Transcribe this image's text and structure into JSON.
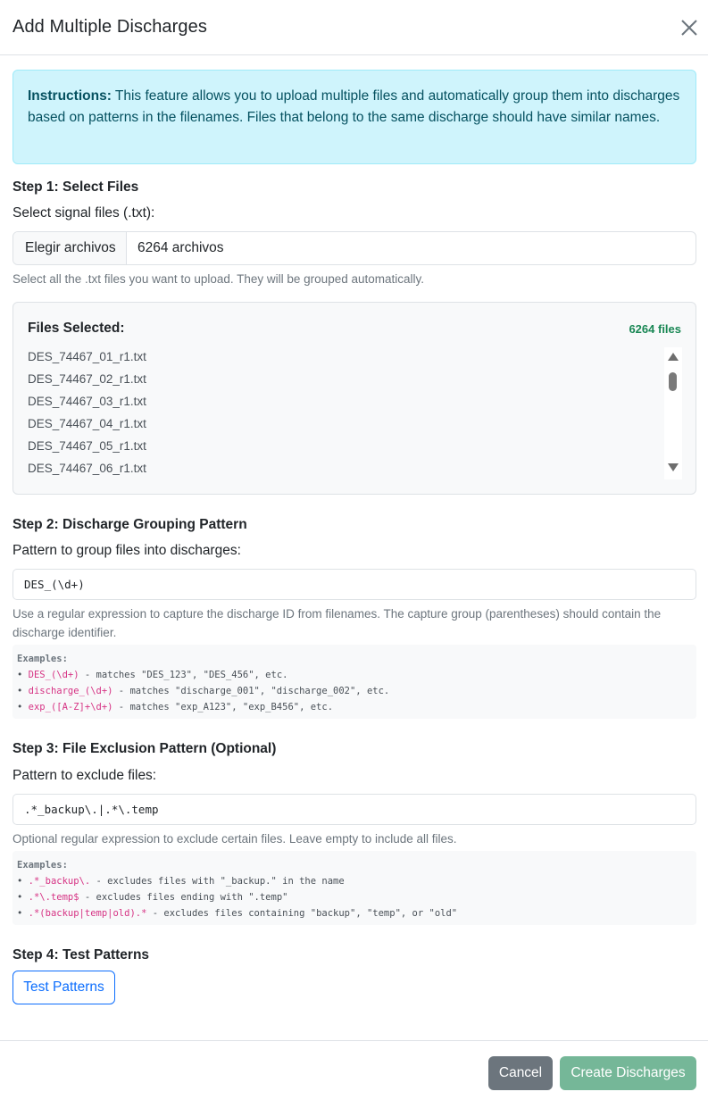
{
  "modal": {
    "title": "Add Multiple Discharges",
    "close_icon": "close-icon"
  },
  "instructions": {
    "label": "Instructions:",
    "text": " This feature allows you to upload multiple files and automatically group them into discharges based on patterns in the filenames. Files that belong to the same discharge should have similar names."
  },
  "step1": {
    "title": "Step 1: Select Files",
    "label": "Select signal files (.txt):",
    "button_label": "Elegir archivos",
    "file_status": "6264 archivos",
    "help": "Select all the .txt files you want to upload. They will be grouped automatically.",
    "files_heading": "Files Selected:",
    "files_count": "6264 files",
    "files": [
      "DES_74467_01_r1.txt",
      "DES_74467_02_r1.txt",
      "DES_74467_03_r1.txt",
      "DES_74467_04_r1.txt",
      "DES_74467_05_r1.txt",
      "DES_74467_06_r1.txt"
    ]
  },
  "step2": {
    "title": "Step 2: Discharge Grouping Pattern",
    "label": "Pattern to group files into discharges:",
    "value": "DES_(\\d+)",
    "help": "Use a regular expression to capture the discharge ID from filenames. The capture group (parentheses) should contain the discharge identifier.",
    "examples_label": "Examples:",
    "examples": [
      {
        "code": "DES_(\\d+)",
        "desc": " - matches \"DES_123\", \"DES_456\", etc."
      },
      {
        "code": "discharge_(\\d+)",
        "desc": " - matches \"discharge_001\", \"discharge_002\", etc."
      },
      {
        "code": "exp_([A-Z]+\\d+)",
        "desc": " - matches \"exp_A123\", \"exp_B456\", etc."
      }
    ]
  },
  "step3": {
    "title": "Step 3: File Exclusion Pattern (Optional)",
    "label": "Pattern to exclude files:",
    "value": ".*_backup\\.|.*\\.temp",
    "help": "Optional regular expression to exclude certain files. Leave empty to include all files.",
    "examples_label": "Examples:",
    "examples": [
      {
        "code": ".*_backup\\.",
        "desc": " - excludes files with \"_backup.\" in the name"
      },
      {
        "code": ".*\\.temp$",
        "desc": " - excludes files ending with \".temp\""
      },
      {
        "code": ".*(backup|temp|old).*",
        "desc": " - excludes files containing \"backup\", \"temp\", or \"old\""
      }
    ]
  },
  "step4": {
    "title": "Step 4: Test Patterns",
    "button_label": "Test Patterns"
  },
  "footer": {
    "cancel_label": "Cancel",
    "create_label": "Create Discharges"
  }
}
